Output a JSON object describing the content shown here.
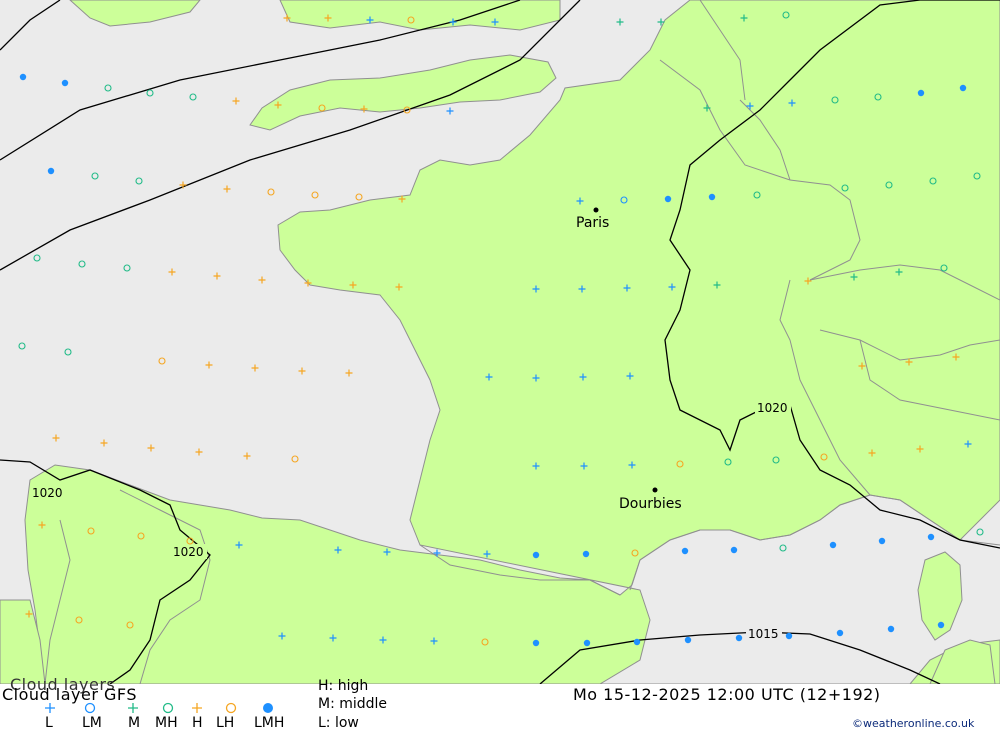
{
  "title_main": "Cloud layer   GFS",
  "title_shadow": "Cloud layers",
  "datetime": "Mo 15-12-2025 12:00 UTC (12+192)",
  "copyright": "©weatheronline.co.uk",
  "legend_keys": [
    {
      "code": "L",
      "symbol": "plus",
      "color": "#1e90ff"
    },
    {
      "code": "LM",
      "symbol": "circle",
      "color": "#1e90ff"
    },
    {
      "code": "M",
      "symbol": "plus",
      "color": "#22bb88"
    },
    {
      "code": "MH",
      "symbol": "circle",
      "color": "#22bb88"
    },
    {
      "code": "H",
      "symbol": "plus",
      "color": "#f5a623"
    },
    {
      "code": "LH",
      "symbol": "circle",
      "color": "#f5a623"
    },
    {
      "code": "LMH",
      "symbol": "dot",
      "color": "#1e90ff"
    }
  ],
  "level_legend": {
    "high": "H: high",
    "middle": "M: middle",
    "low": "L: low"
  },
  "cities": [
    {
      "name": "Paris"
    },
    {
      "name": "Dourbies"
    }
  ],
  "isobars": [
    {
      "label": "1020"
    },
    {
      "label": "1020"
    },
    {
      "label": "1020"
    },
    {
      "label": "1015"
    }
  ],
  "colors": {
    "land": "#ccff99",
    "sea": "#ebebeb",
    "border": "#909090",
    "isobar": "#000000",
    "plus_blue": "#1e90ff",
    "circle_teal": "#22bb88",
    "plus_orange": "#f5a623"
  }
}
